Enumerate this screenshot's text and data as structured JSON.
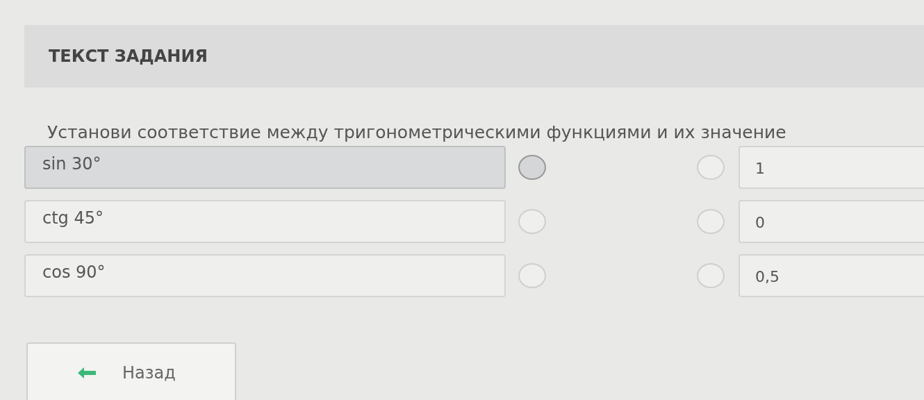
{
  "header": {
    "title": "ТЕКСТ ЗАДАНИЯ"
  },
  "question": "Установи соответствие между тригонометрическими функциями и их значение",
  "left_items": [
    {
      "label": "sin 30°",
      "selected": true
    },
    {
      "label": "ctg 45°",
      "selected": false
    },
    {
      "label": "cos 90°",
      "selected": false
    }
  ],
  "right_items": [
    {
      "label": "1",
      "selected": false
    },
    {
      "label": "0",
      "selected": false
    },
    {
      "label": "0,5",
      "selected": false
    }
  ],
  "back_button": {
    "label": "Назад"
  }
}
